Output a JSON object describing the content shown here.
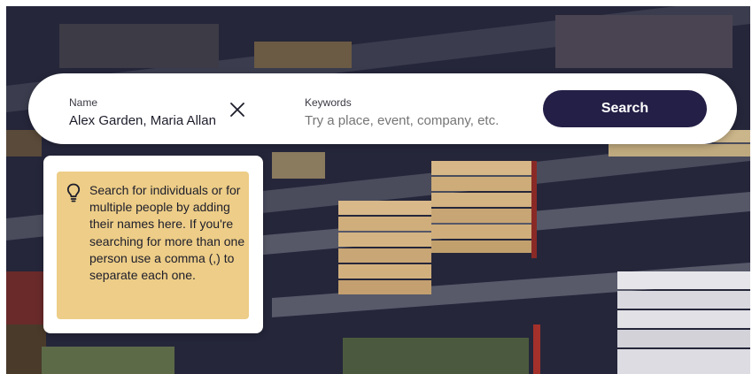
{
  "search": {
    "name_label": "Name",
    "name_value": "Alex Garden, Maria Allan",
    "keywords_label": "Keywords",
    "keywords_placeholder": "Try a place, event, company, etc.",
    "search_button": "Search"
  },
  "tooltip": {
    "text": "Search for individuals or for multiple people by adding their names here. If you're searching for more than one person use a comma (,) to separate each one."
  },
  "icons": {
    "clear": "close-icon",
    "hint": "lightbulb-icon"
  },
  "colors": {
    "search_button_bg": "#241f47",
    "tooltip_bg": "#edcd87"
  }
}
